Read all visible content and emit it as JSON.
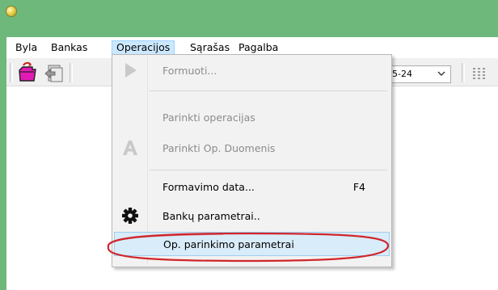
{
  "menubar": {
    "items": [
      {
        "label": "Byla"
      },
      {
        "label": "Bankas"
      },
      {
        "label": "Operacijos"
      },
      {
        "label": "Sąrašas"
      },
      {
        "label": "Pagalba"
      }
    ]
  },
  "toolbar": {
    "date_value": "5-24"
  },
  "dropdown": {
    "items": [
      {
        "label": "Formuoti...",
        "enabled": false,
        "icon": "play-icon"
      },
      {
        "label": "Parinkti operacijas",
        "enabled": false
      },
      {
        "label": "Parinkti Op. Duomenis",
        "enabled": false,
        "icon": "letter-a-icon"
      },
      {
        "label": "Formavimo data...",
        "shortcut": "F4",
        "enabled": true
      },
      {
        "label": "Bankų parametrai..",
        "enabled": true,
        "icon": "gear-icon"
      },
      {
        "label": "Op. parinkimo parametrai",
        "enabled": true,
        "highlighted": true
      }
    ]
  },
  "colors": {
    "titlebar": "#6fb87c",
    "annotation_ellipse": "#d0262b",
    "highlight": "#d9ecf9"
  }
}
